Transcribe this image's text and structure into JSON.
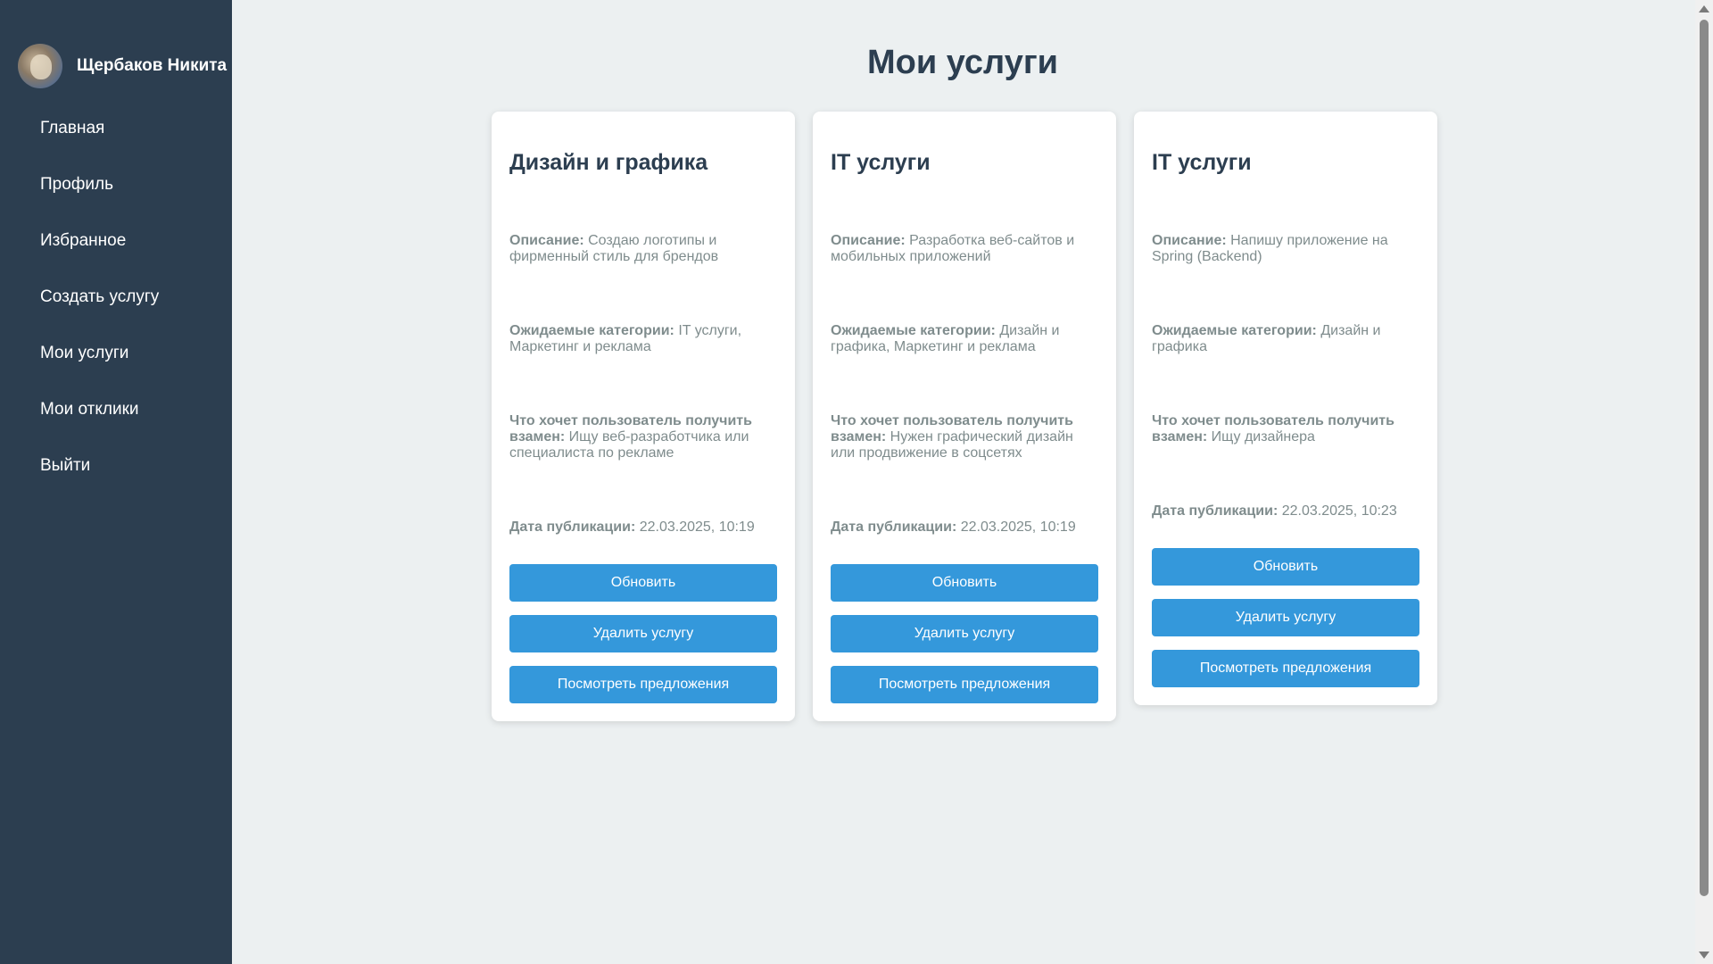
{
  "user": {
    "name": "Щербаков Никита"
  },
  "nav": [
    {
      "label": "Главная"
    },
    {
      "label": "Профиль"
    },
    {
      "label": "Избранное"
    },
    {
      "label": "Создать услугу"
    },
    {
      "label": "Мои услуги"
    },
    {
      "label": "Мои отклики"
    },
    {
      "label": "Выйти"
    }
  ],
  "page": {
    "title": "Мои услуги"
  },
  "labels": {
    "description": "Описание:",
    "categories": "Ожидаемые категории:",
    "wants": "Что хочет пользователь получить взамен:",
    "date": "Дата публикации:",
    "update": "Обновить",
    "delete": "Удалить услугу",
    "offers": "Посмотреть предложения"
  },
  "services": [
    {
      "title": "Дизайн и графика",
      "description": "Создаю логотипы и фирменный стиль для брендов",
      "categories": "IT услуги, Маркетинг и реклама",
      "wants": "Ищу веб-разработчика или специалиста по рекламе",
      "date": "22.03.2025, 10:19"
    },
    {
      "title": "IT услуги",
      "description": "Разработка веб-сайтов и мобильных приложений",
      "categories": "Дизайн и графика, Маркетинг и реклама",
      "wants": "Нужен графический дизайн или продвижение в соцсетях",
      "date": "22.03.2025, 10:19"
    },
    {
      "title": "IT услуги",
      "description": "Напишу приложение на Spring (Backend)",
      "categories": "Дизайн и графика",
      "wants": "Ищу дизайнера",
      "date": "22.03.2025, 10:23"
    }
  ],
  "colors": {
    "sidebar": "#2c3e50",
    "background": "#ecf0f1",
    "accent": "#3498db",
    "muted": "#7f8c8d"
  }
}
